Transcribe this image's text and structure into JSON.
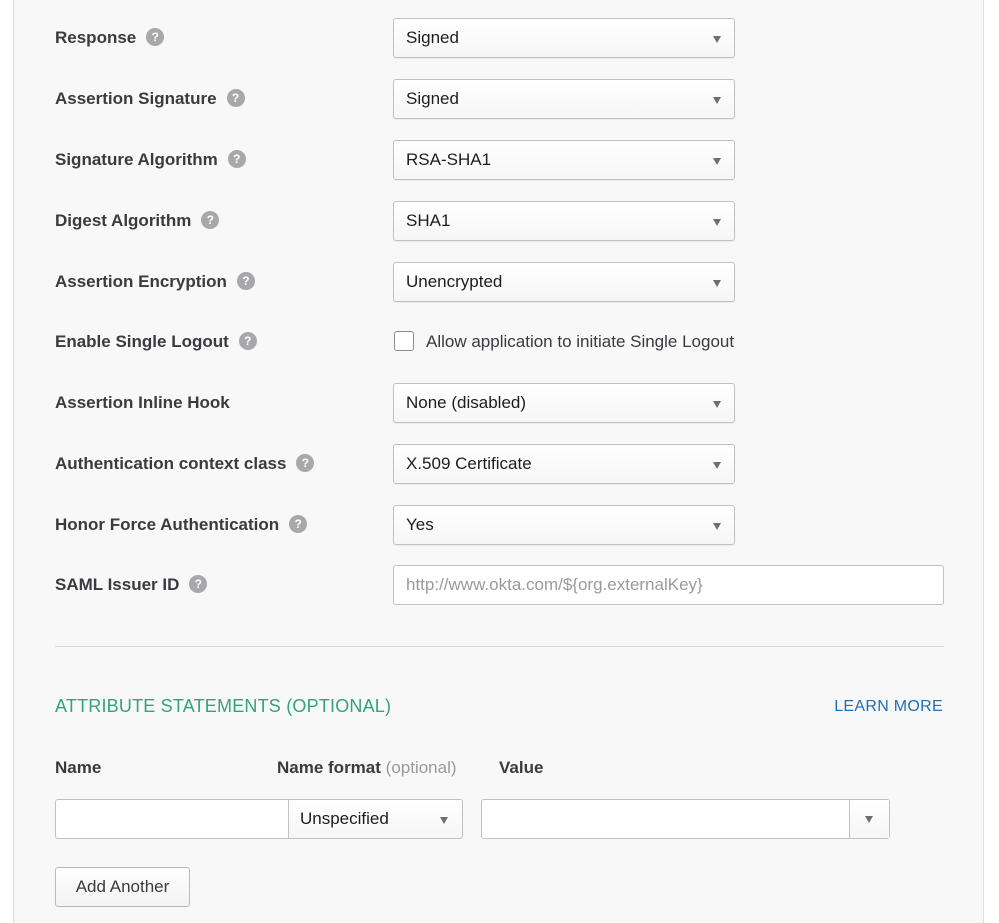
{
  "settings": [
    {
      "label": "Response",
      "help": true,
      "type": "select",
      "value": "Signed"
    },
    {
      "label": "Assertion Signature",
      "help": true,
      "type": "select",
      "value": "Signed"
    },
    {
      "label": "Signature Algorithm",
      "help": true,
      "type": "select",
      "value": "RSA-SHA1"
    },
    {
      "label": "Digest Algorithm",
      "help": true,
      "type": "select",
      "value": "SHA1"
    },
    {
      "label": "Assertion Encryption",
      "help": true,
      "type": "select",
      "value": "Unencrypted"
    },
    {
      "label": "Enable Single Logout",
      "help": true,
      "type": "checkbox",
      "checked": false,
      "checkbox_label": "Allow application to initiate Single Logout"
    },
    {
      "label": "Assertion Inline Hook",
      "help": false,
      "type": "select",
      "value": "None (disabled)"
    },
    {
      "label": "Authentication context class",
      "help": true,
      "type": "select",
      "value": "X.509 Certificate"
    },
    {
      "label": "Honor Force Authentication",
      "help": true,
      "type": "select",
      "value": "Yes"
    },
    {
      "label": "SAML Issuer ID",
      "help": true,
      "type": "text",
      "value": "",
      "placeholder": "http://www.okta.com/${org.externalKey}"
    }
  ],
  "help_glyph": "?",
  "attribute_statements": {
    "title": "ATTRIBUTE STATEMENTS (OPTIONAL)",
    "learn_more": "LEARN MORE",
    "columns": {
      "name": "Name",
      "name_format": "Name format",
      "name_format_hint": "(optional)",
      "value": "Value"
    },
    "row": {
      "name": "",
      "name_format": "Unspecified",
      "value": ""
    },
    "add_button": "Add Another"
  },
  "colors": {
    "section_title": "#33a37b",
    "link": "#1f6fb2",
    "help_icon": "#a8a8ab",
    "panel_bg": "#f8f8f8"
  },
  "icons": {
    "help": "help-question-icon",
    "dropdown": "caret-down-icon"
  }
}
